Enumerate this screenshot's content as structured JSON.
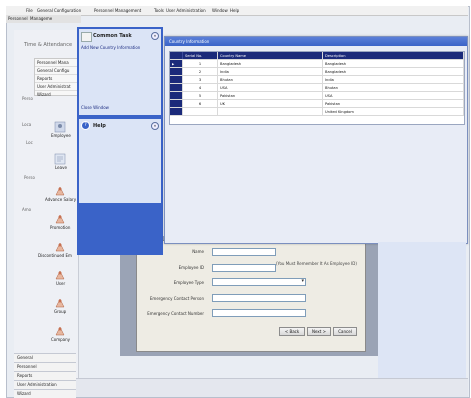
{
  "app": {
    "menu": [
      "File",
      "General Configuration",
      "Personnel Management",
      "Tools",
      "User Administration",
      "Window",
      "Help"
    ],
    "tabs": [
      "Personnel",
      "Manageme"
    ]
  },
  "left_panel": {
    "title": "Time & Attendance",
    "tree": [
      "Personnel Mana",
      "General Configu",
      "Reports",
      "User Administrat",
      "Wizard"
    ],
    "side_labels": [
      "Perso",
      "Loca",
      "Loc",
      "Perso",
      "Amo"
    ],
    "icons": [
      {
        "label": "Employee",
        "icon": "employee-icon"
      },
      {
        "label": "Leave",
        "icon": "leave-icon"
      },
      {
        "label": "Advance Salary",
        "icon": "advance-salary-icon"
      },
      {
        "label": "Promotion",
        "icon": "promotion-icon"
      },
      {
        "label": "Discontinued Em",
        "icon": "discontinued-employee-icon"
      },
      {
        "label": "User",
        "icon": "user-icon"
      },
      {
        "label": "Group",
        "icon": "group-icon"
      },
      {
        "label": "Company",
        "icon": "company-icon"
      }
    ],
    "bottom_items": [
      "General",
      "Personnel",
      "Reports",
      "User Administration",
      "Wizard"
    ]
  },
  "task_pane": {
    "common_task_title": "Common Task",
    "task_link": "Add New Country Information",
    "close_window": "Close Window",
    "help_title": "Help"
  },
  "country_window": {
    "title": "Country Information",
    "columns": [
      "Serial No.",
      "Country Name",
      "Description"
    ],
    "rows": [
      {
        "serial": "1",
        "name": "Bangladesh",
        "desc": "Bangladesh"
      },
      {
        "serial": "2",
        "name": "India",
        "desc": "Bangladesh"
      },
      {
        "serial": "3",
        "name": "Bhutan",
        "desc": "India"
      },
      {
        "serial": "4",
        "name": "USA",
        "desc": "Bhutan"
      },
      {
        "serial": "5",
        "name": "Pakistan",
        "desc": "USA"
      },
      {
        "serial": "6",
        "name": "UK",
        "desc": "Pakistan"
      },
      {
        "serial": "",
        "name": "",
        "desc": "United Kingdom"
      }
    ]
  },
  "wizard": {
    "fields": [
      {
        "label": "Name",
        "value": ""
      },
      {
        "label": "Employee ID",
        "value": ""
      },
      {
        "label": "Employee Type",
        "value": ""
      },
      {
        "label": "Emergency Contact Person",
        "value": ""
      },
      {
        "label": "Emergency Contact Number",
        "value": ""
      }
    ],
    "hint": "(You Must Remember It As Employee ID)",
    "back": "< Back",
    "next": "Next >",
    "cancel": "Cancel"
  },
  "colors": {
    "accent": "#3a63c8",
    "pane": "#c9d7f3",
    "selection": "#1b2a7a",
    "window_bg": "#e8ecf6"
  }
}
